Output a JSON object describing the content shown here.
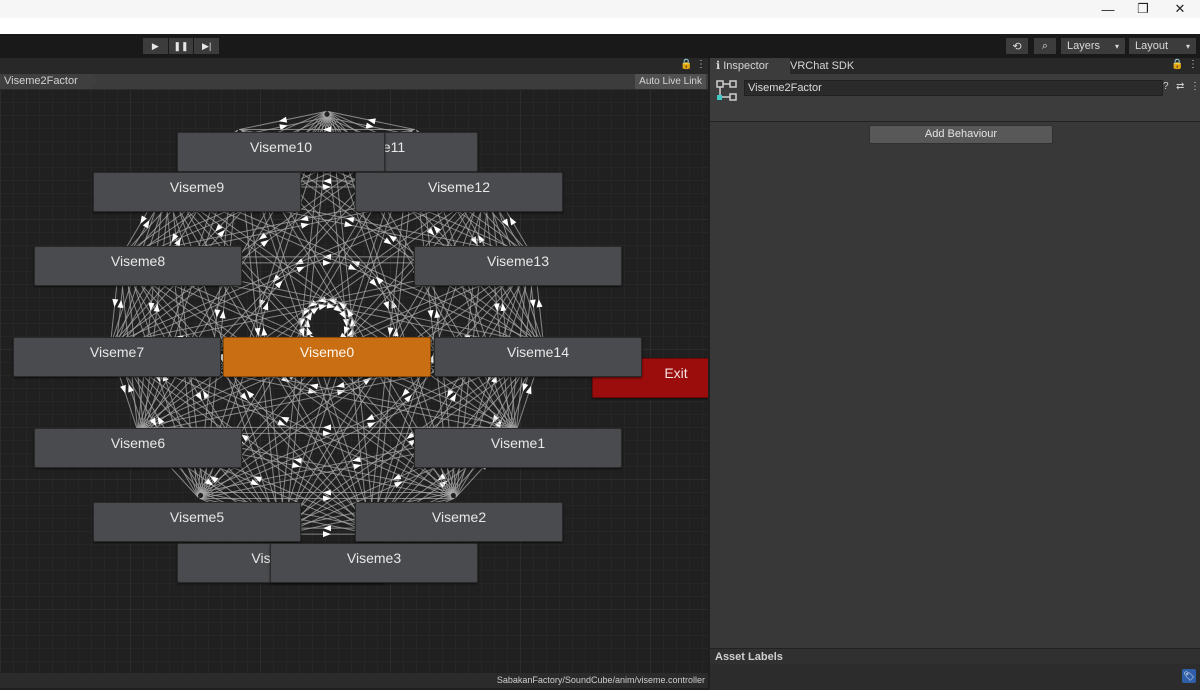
{
  "window": {
    "minimize": "—",
    "restore": "❐",
    "close": "✕"
  },
  "playbar": {
    "play": "▶",
    "pause": "❚❚",
    "step": "▶|"
  },
  "toolbar": {
    "history": "⟲",
    "search": "⌕",
    "layers": "Layers",
    "layout": "Layout",
    "arrow": "▾"
  },
  "animator": {
    "breadcrumb": "Viseme2Factor",
    "auto_live_link": "Auto Live Link",
    "lock": "🔒",
    "menu": "⋮",
    "footer_path": "SabakanFactory/SoundCube/anim/viseme.controller",
    "exit_label": "Exit",
    "states": {
      "viseme0": "Viseme0",
      "viseme1": "Viseme1",
      "viseme2": "Viseme2",
      "viseme3": "Viseme3",
      "viseme4": "Vis",
      "viseme5": "Viseme5",
      "viseme6": "Viseme6",
      "viseme7": "Viseme7",
      "viseme8": "Viseme8",
      "viseme9": "Viseme9",
      "viseme10": "Viseme10",
      "viseme11": "e11",
      "viseme12": "Viseme12",
      "viseme13": "Viseme13",
      "viseme14": "Viseme14"
    }
  },
  "inspector": {
    "tabs": {
      "inspector": "Inspector",
      "sdk": "VRChat SDK"
    },
    "info_icon": "ℹ",
    "lock": "🔒",
    "menu": "⋮",
    "object_name": "Viseme2Factor",
    "help": "?",
    "settings": "⇄",
    "add_behaviour": "Add Behaviour",
    "asset_labels": "Asset Labels",
    "label_icon": "🏷"
  },
  "colors": {
    "default_state": "#c96e12",
    "exit_state": "#9b0d0d",
    "state": "#4a4b4e",
    "transition": "#a8a8a8"
  }
}
